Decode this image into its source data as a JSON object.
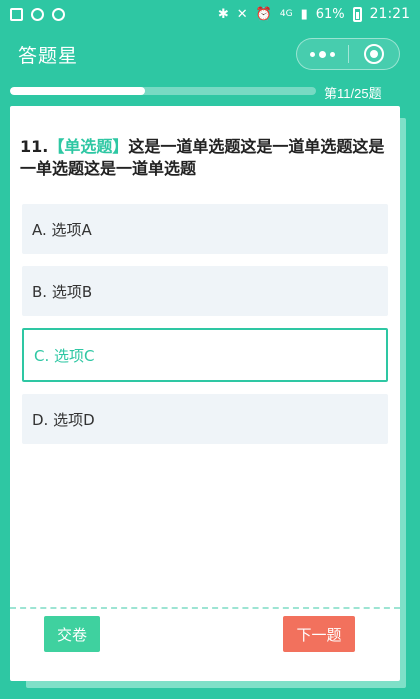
{
  "status_bar": {
    "network": "4G",
    "battery": "61%",
    "time": "21:21"
  },
  "nav": {
    "title": "答题星"
  },
  "progress": {
    "current": 11,
    "total": 25,
    "label": "第11/25题",
    "fraction": 0.44
  },
  "question": {
    "number": "11.",
    "type_label": "【单选题】",
    "text": "这是一道单选题这是一道单选题这是一单选题这是一道单选题"
  },
  "options": [
    {
      "label": "A. 选项A",
      "selected": false
    },
    {
      "label": "B. 选项B",
      "selected": false
    },
    {
      "label": "C. 选项C",
      "selected": true
    },
    {
      "label": "D. 选项D",
      "selected": false
    }
  ],
  "buttons": {
    "submit": "交卷",
    "next": "下一题"
  },
  "colors": {
    "brand": "#2ec7a3",
    "submit": "#3fd19f",
    "next": "#f2715d"
  }
}
